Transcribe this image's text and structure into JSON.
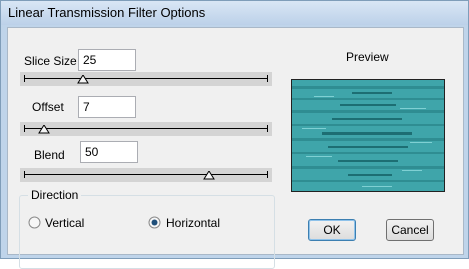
{
  "window": {
    "title": "Linear Transmission Filter Options"
  },
  "controls": {
    "slice_size": {
      "label": "Slice Size",
      "value": "25",
      "slider_level": 0.24
    },
    "offset": {
      "label": "Offset",
      "value": "7",
      "slider_level": 0.08
    },
    "blend": {
      "label": "Blend",
      "value": "50",
      "slider_level": 0.76
    }
  },
  "direction": {
    "legend": "Direction",
    "options": [
      {
        "label": "Vertical",
        "selected": false
      },
      {
        "label": "Horizontal",
        "selected": true
      }
    ]
  },
  "preview": {
    "label": "Preview",
    "color": "#3fa5aa"
  },
  "buttons": {
    "ok": "OK",
    "cancel": "Cancel"
  }
}
